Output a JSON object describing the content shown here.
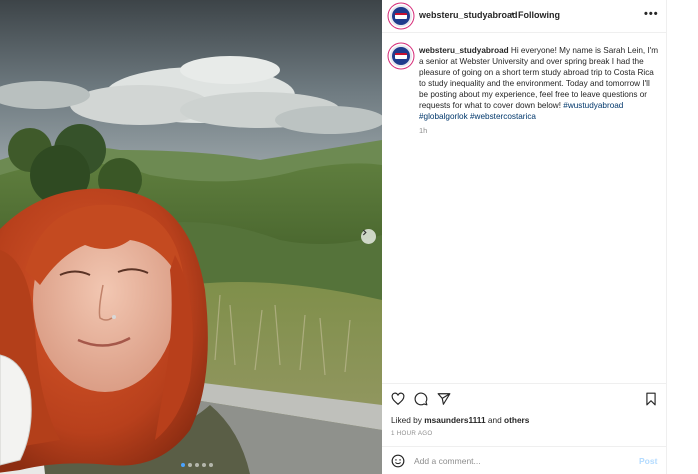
{
  "post": {
    "username": "websteru_studyabroad",
    "separator": "•",
    "following_label": "Following",
    "more_label": "•••",
    "caption_text": "Hi everyone! My name is Sarah Lein, I'm a senior at Webster University and over spring break I had the pleasure of going on a short term study abroad trip to Costa Rica to study inequality and the environment. Today and tomorrow I'll be posting about my experience, feel free to leave questions or requests for what to cover down below!",
    "hashtags": [
      "#wustudyabroad",
      "#globalgorlok",
      "#webstercostarica"
    ],
    "caption_age": "1h",
    "liked_prefix": "Liked by",
    "liked_user": "msaunders1111",
    "liked_and": "and",
    "liked_others": "others",
    "post_time": "1 HOUR AGO"
  },
  "comment": {
    "placeholder": "Add a comment...",
    "post_label": "Post"
  },
  "carousel": {
    "slide_count": 5,
    "active_index": 0
  },
  "icons": {
    "like": "heart-icon",
    "comment": "comment-icon",
    "share": "share-icon",
    "save": "bookmark-icon",
    "emoji": "emoji-icon",
    "next": "chevron-right-icon",
    "more": "more-icon"
  },
  "colors": {
    "hashtag": "#00376b",
    "post_button": "#b3dbff",
    "meta_text": "#8e8e8e",
    "carousel_dot_active": "#4aa3ff"
  }
}
